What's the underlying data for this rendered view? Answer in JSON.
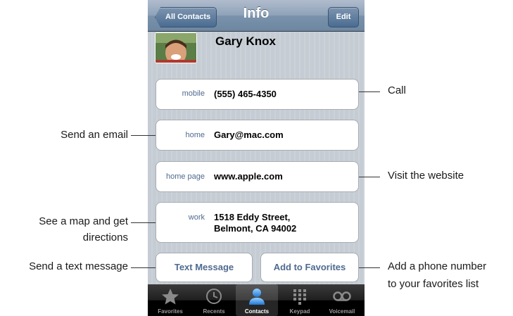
{
  "navbar": {
    "back_label": "All Contacts",
    "title": "Info",
    "edit_label": "Edit"
  },
  "contact": {
    "name": "Gary Knox"
  },
  "fields": [
    {
      "label": "mobile",
      "value": "(555) 465-4350"
    },
    {
      "label": "home",
      "value": "Gary@mac.com"
    },
    {
      "label": "home page",
      "value": "www.apple.com"
    },
    {
      "label": "work",
      "value_line1": "1518 Eddy Street,",
      "value_line2": "Belmont, CA 94002"
    }
  ],
  "buttons": {
    "text_message": "Text Message",
    "add_favorites": "Add to Favorites"
  },
  "tabs": [
    {
      "label": "Favorites",
      "icon": "star-icon"
    },
    {
      "label": "Recents",
      "icon": "clock-icon"
    },
    {
      "label": "Contacts",
      "icon": "person-icon"
    },
    {
      "label": "Keypad",
      "icon": "keypad-icon"
    },
    {
      "label": "Voicemail",
      "icon": "voicemail-icon"
    }
  ],
  "active_tab": "Contacts",
  "callouts": {
    "call": "Call",
    "email": "Send an email",
    "website": "Visit the website",
    "map_line1": "See a map and get",
    "map_line2": "directions",
    "text": "Send a text message",
    "favorites_line1": "Add a phone number",
    "favorites_line2": "to your favorites list"
  },
  "colors": {
    "label_blue": "#4f6a8f",
    "nav_blue": "#6d87a2",
    "tab_highlight": "#2a7fd8"
  }
}
